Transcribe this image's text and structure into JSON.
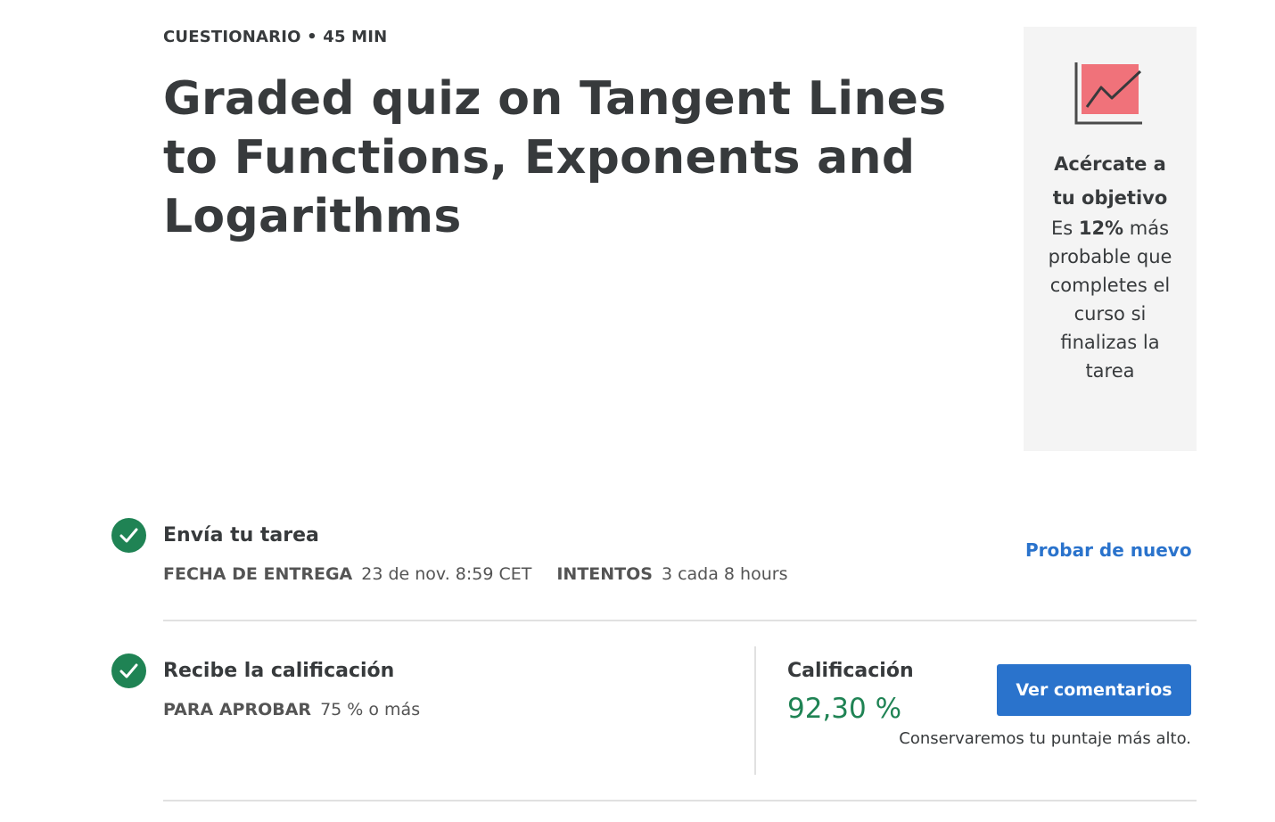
{
  "header": {
    "eyebrow": "CUESTIONARIO • 45 MIN",
    "title": "Graded quiz on Tangent Lines to Functions, Exponents and Logarithms"
  },
  "goal_card": {
    "icon": "trending-chart-icon",
    "heading_line1": "Acércate a",
    "heading_line2": "tu objetivo",
    "body_prefix": "Es ",
    "body_highlight": "12%",
    "body_suffix": " más probable que completes el curso si finalizas la tarea"
  },
  "submit_section": {
    "title": "Envía tu tarea",
    "due_label": "FECHA DE ENTREGA",
    "due_value": "23 de nov. 8:59 CET",
    "attempts_label": "INTENTOS",
    "attempts_value": "3 cada 8 hours",
    "retry_link": "Probar de nuevo"
  },
  "grade_section": {
    "title": "Recibe la calificación",
    "pass_label": "PARA APROBAR",
    "pass_value": "75 % o más",
    "grade_label": "Calificación",
    "grade_value": "92,30 %",
    "feedback_button": "Ver comentarios",
    "keep_note": "Conservaremos tu puntaje más alto."
  },
  "colors": {
    "success": "#1f8354",
    "link": "#2a73cc",
    "card_bg": "#f4f4f4",
    "chart_fill": "#f0727a"
  }
}
